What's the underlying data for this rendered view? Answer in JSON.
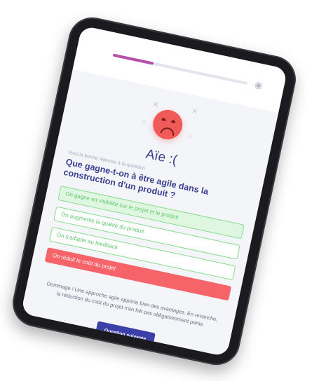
{
  "progress": {
    "value": 0.3,
    "icon": "trophy-icon"
  },
  "result": {
    "title": "Aïe :(",
    "icon": "sad-face-icon"
  },
  "question": {
    "prompt_label": "Voici la bonne réponse à la question",
    "text": "Que gagne-t-on à être agile dans la construction d'un produit ?"
  },
  "answers": [
    {
      "label": "On gagne en visibilité sur le projet et le produit",
      "status": "correct-selected"
    },
    {
      "label": "On augmente la qualité du produit",
      "status": "correct"
    },
    {
      "label": "On s'adapte au feedback",
      "status": "correct"
    },
    {
      "label": "On réduit le coût du projet",
      "status": "wrong"
    }
  ],
  "feedback": "Dommage ! Une approche agile apporte bien des avantages. En revanche, la réduction du coût du projet n'en fait pas obligatoirement partie.",
  "next_button": {
    "label": "Question suivante"
  },
  "colors": {
    "accent": "#3b3f92",
    "progress": "#b44ea8",
    "correct": "#5fc86a",
    "wrong": "#f6646a",
    "button": "#3d3fa8"
  }
}
